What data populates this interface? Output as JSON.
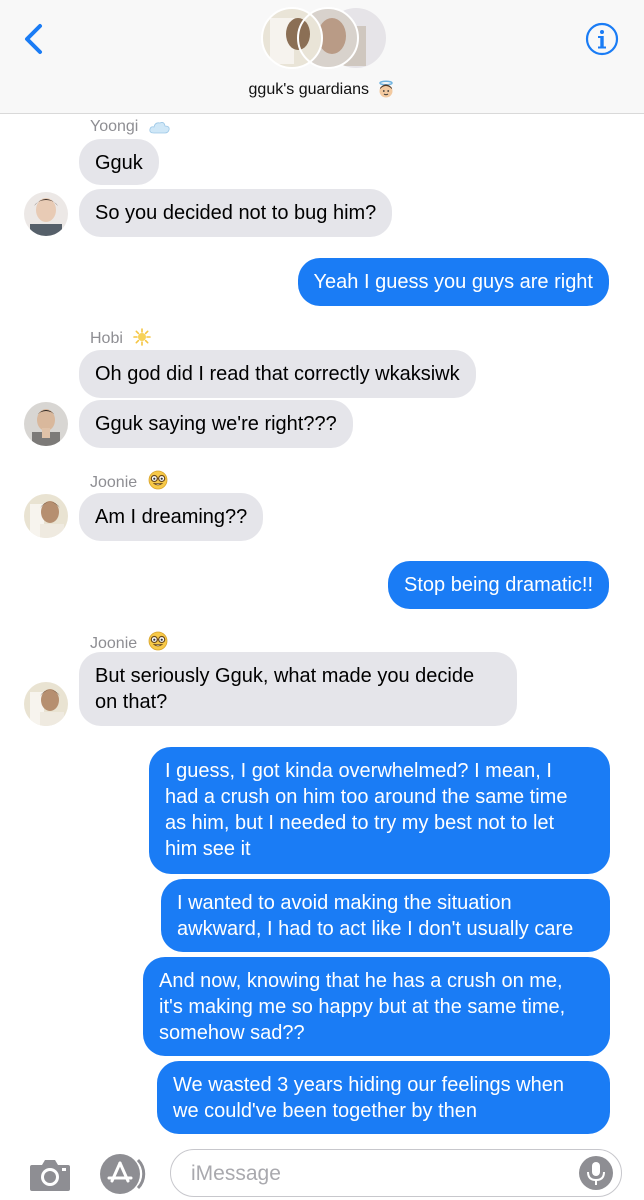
{
  "header": {
    "group_name": "gguk's guardians",
    "group_emoji_icon": "angel-face-icon",
    "back_icon": "chevron-left-icon",
    "info_icon": "info-icon"
  },
  "messages": [
    {
      "sender": "Yoongi",
      "sender_emoji": "cloud-icon"
    },
    {
      "text": "Gguk"
    },
    {
      "text": "So you decided not to bug him?"
    },
    {
      "text": "Yeah I guess you guys are right"
    },
    {
      "sender": "Hobi",
      "sender_emoji": "sun-icon"
    },
    {
      "text": "Oh god did I read that correctly wkaksiwk"
    },
    {
      "text": "Gguk saying we're right???"
    },
    {
      "sender": "Joonie",
      "sender_emoji": "nerd-face-icon"
    },
    {
      "text": "Am I dreaming??"
    },
    {
      "text": "Stop being dramatic!!"
    },
    {
      "sender": "Joonie",
      "sender_emoji": "nerd-face-icon"
    },
    {
      "text": "But seriously Gguk, what made you decide\non that?"
    },
    {
      "text": "I guess, I got kinda overwhelmed? I mean, I\nhad a crush on him too around the same time\nas him, but I needed to try my best not to let\nhim see it"
    },
    {
      "text": "I wanted to avoid making the situation\nawkward, I had to act like I don't usually care"
    },
    {
      "text": "And now, knowing that he has a crush on me,\nit's making me so happy but at the same time,\nsomehow sad??"
    },
    {
      "text": "We wasted 3 years hiding our feelings when\nwe could've been together by then"
    }
  ],
  "composer": {
    "placeholder": "iMessage",
    "camera_icon": "camera-icon",
    "apps_icon": "app-store-icon",
    "mic_icon": "microphone-icon"
  },
  "colors": {
    "outgoing_bubble": "#1a7cf5",
    "incoming_bubble": "#e5e5ea",
    "accent": "#1a7cf5"
  }
}
